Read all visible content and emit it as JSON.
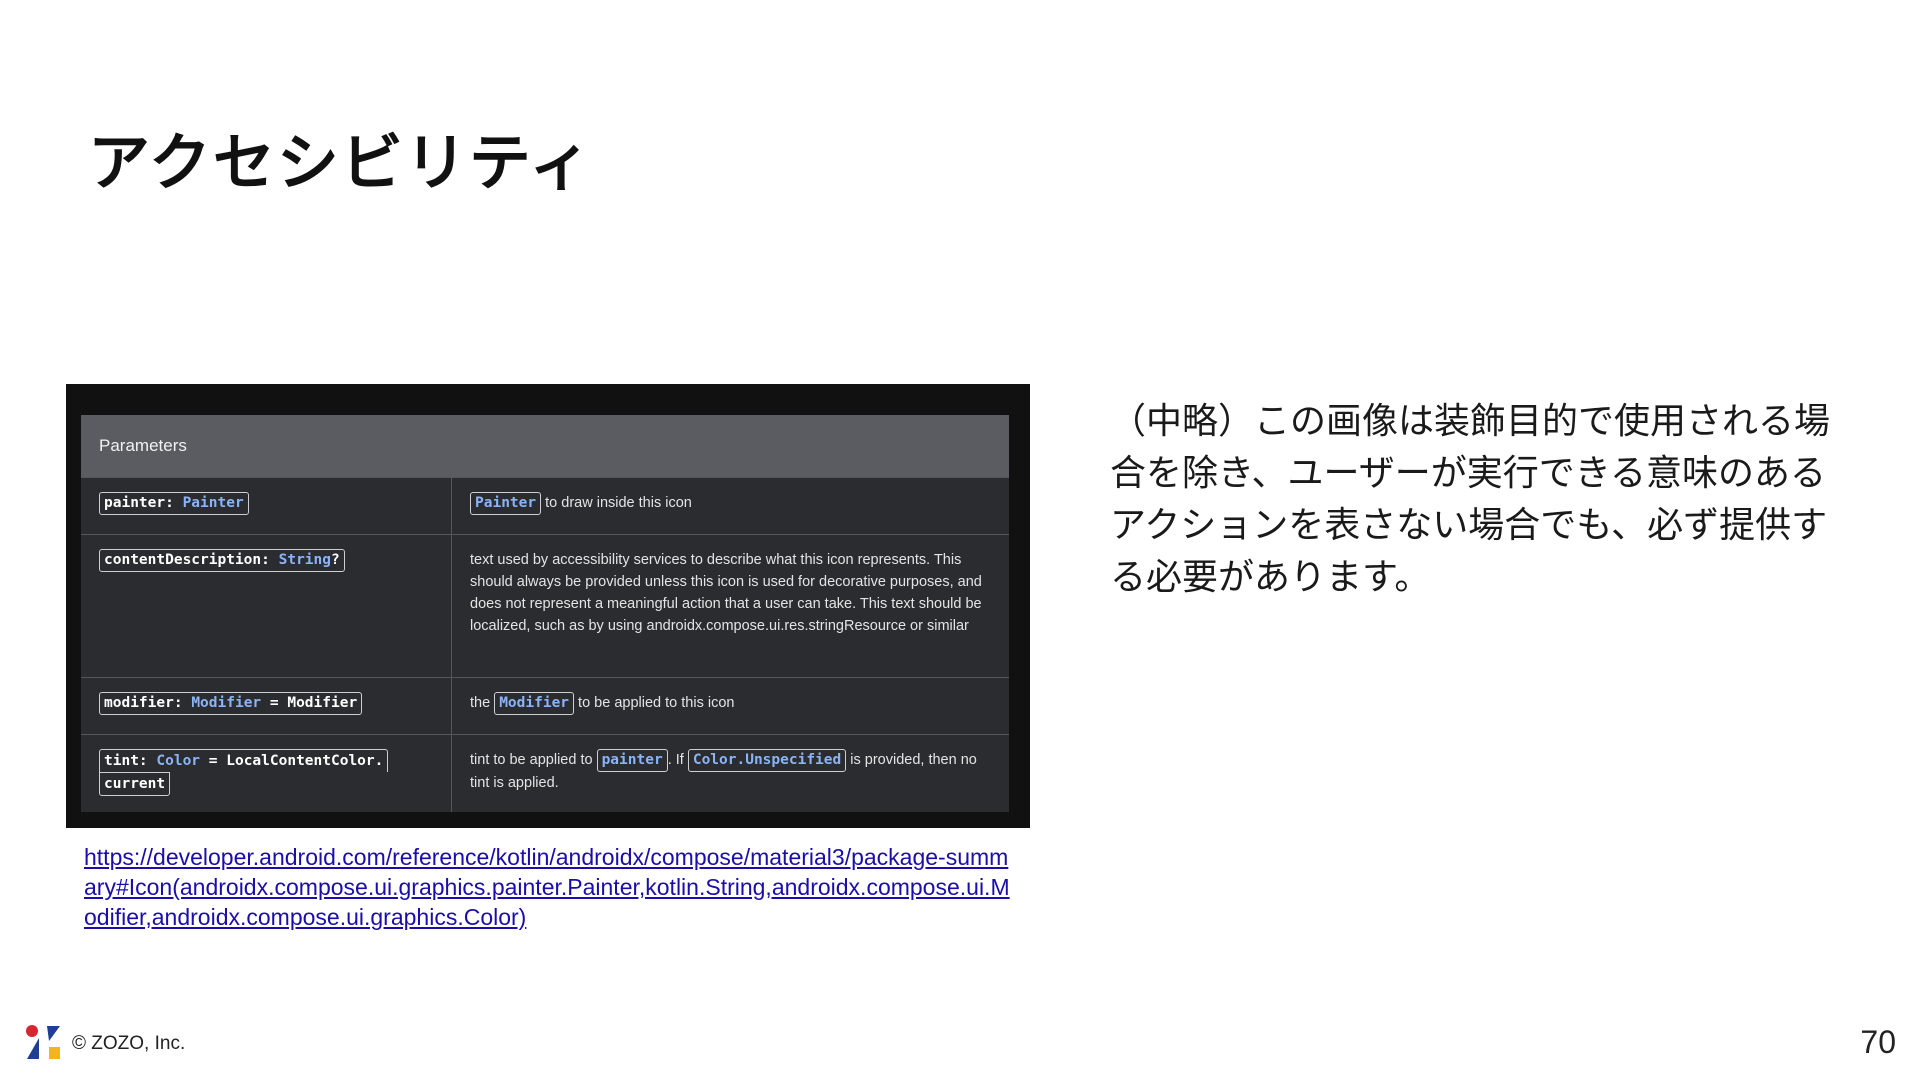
{
  "slide": {
    "title": "アクセシビリティ",
    "body": "（中略）この画像は装飾目的で使用される場合を除き、ユーザーが実行できる意味のあるアクションを表さない場合でも、必ず提供する必要があります。",
    "link": "https://developer.android.com/reference/kotlin/androidx/compose/material3/package-summary#Icon(androidx.compose.ui.graphics.painter.Painter,kotlin.String,androidx.compose.ui.Modifier,androidx.compose.ui.graphics.Color)",
    "copyright": "© ZOZO, Inc.",
    "page_number": "70"
  },
  "doc_table": {
    "header": "Parameters",
    "rows": [
      {
        "param_name": "painter: ",
        "param_type": "Painter",
        "desc_code": "Painter",
        "desc_text": " to draw inside this icon"
      },
      {
        "param_name": "contentDescription: ",
        "param_type": "String",
        "param_suffix": "?",
        "desc_text": "text used by accessibility services to describe what this icon represents. This should always be provided unless this icon is used for decorative purposes, and does not represent a meaningful action that a user can take. This text should be localized, such as by using androidx.compose.ui.res.stringResource or similar"
      },
      {
        "param_name": "modifier: ",
        "param_type": "Modifier",
        "param_suffix": " = Modifier",
        "desc_prefix": "the ",
        "desc_code": "Modifier",
        "desc_text": " to be applied to this icon"
      },
      {
        "param_name": "tint: ",
        "param_type": "Color",
        "param_suffix": " = LocalContentColor.",
        "param_line2": "current",
        "desc_prefix": "tint to be applied to ",
        "desc_code": "painter",
        "desc_mid": ". If ",
        "desc_code2": "Color.Unspecified",
        "desc_text": " is provided, then no tint is applied."
      }
    ]
  },
  "colors": {
    "logo_red": "#d7262f",
    "logo_blue": "#1c3f95",
    "logo_yellow": "#f3b519",
    "link": "#1a0dab",
    "code_type": "#8ab4f8"
  }
}
